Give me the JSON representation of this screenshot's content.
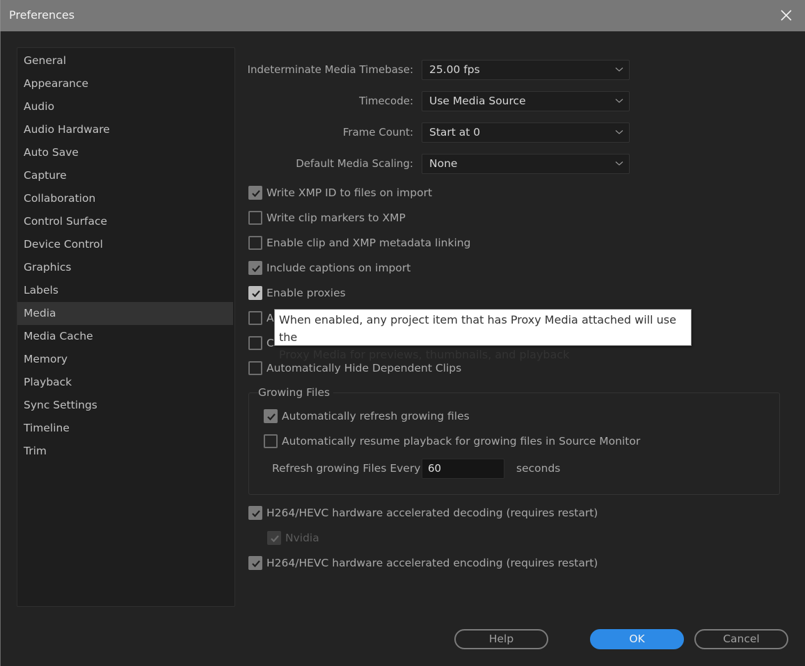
{
  "window": {
    "title": "Preferences",
    "close_icon": "close-icon"
  },
  "sidebar": {
    "selected": "Media",
    "items": [
      {
        "label": "General"
      },
      {
        "label": "Appearance"
      },
      {
        "label": "Audio"
      },
      {
        "label": "Audio Hardware"
      },
      {
        "label": "Auto Save"
      },
      {
        "label": "Capture"
      },
      {
        "label": "Collaboration"
      },
      {
        "label": "Control Surface"
      },
      {
        "label": "Device Control"
      },
      {
        "label": "Graphics"
      },
      {
        "label": "Labels"
      },
      {
        "label": "Media"
      },
      {
        "label": "Media Cache"
      },
      {
        "label": "Memory"
      },
      {
        "label": "Playback"
      },
      {
        "label": "Sync Settings"
      },
      {
        "label": "Timeline"
      },
      {
        "label": "Trim"
      }
    ]
  },
  "settings": {
    "dropdowns": [
      {
        "label": "Indeterminate Media Timebase:",
        "value": "25.00 fps"
      },
      {
        "label": "Timecode:",
        "value": "Use Media Source"
      },
      {
        "label": "Frame Count:",
        "value": "Start at 0"
      },
      {
        "label": "Default Media Scaling:",
        "value": "None"
      }
    ],
    "checkboxes": [
      {
        "label": "Write XMP ID to files on import",
        "checked": true
      },
      {
        "label": "Write clip markers to XMP",
        "checked": false
      },
      {
        "label": "Enable clip and XMP metadata linking",
        "checked": false
      },
      {
        "label": "Include captions on import",
        "checked": true
      },
      {
        "label": "Enable proxies",
        "checked": true
      },
      {
        "label": "A",
        "checked": false
      },
      {
        "label": "C",
        "checked": false
      },
      {
        "label": "Automatically Hide Dependent Clips",
        "checked": false
      }
    ],
    "growing_files": {
      "title": "Growing Files",
      "auto_refresh": {
        "label": "Automatically refresh growing files",
        "checked": true
      },
      "auto_resume": {
        "label": "Automatically resume playback for growing files in Source Monitor",
        "checked": false
      },
      "refresh_label": "Refresh growing Files Every",
      "refresh_value": "60",
      "refresh_unit": "seconds"
    },
    "hw_decoding": {
      "label": "H264/HEVC hardware accelerated decoding (requires restart)",
      "checked": true
    },
    "nvidia": {
      "label": "Nvidia",
      "checked": true,
      "disabled": true
    },
    "hw_encoding": {
      "label": "H264/HEVC hardware accelerated encoding (requires restart)",
      "checked": true
    }
  },
  "tooltip": {
    "line1": "When enabled, any project item that has Proxy Media attached will use the",
    "line2": "Proxy Media for previews, thumbnails, and playback"
  },
  "buttons": {
    "help": "Help",
    "ok": "OK",
    "cancel": "Cancel",
    "ok_color": "#2d8ae6"
  }
}
